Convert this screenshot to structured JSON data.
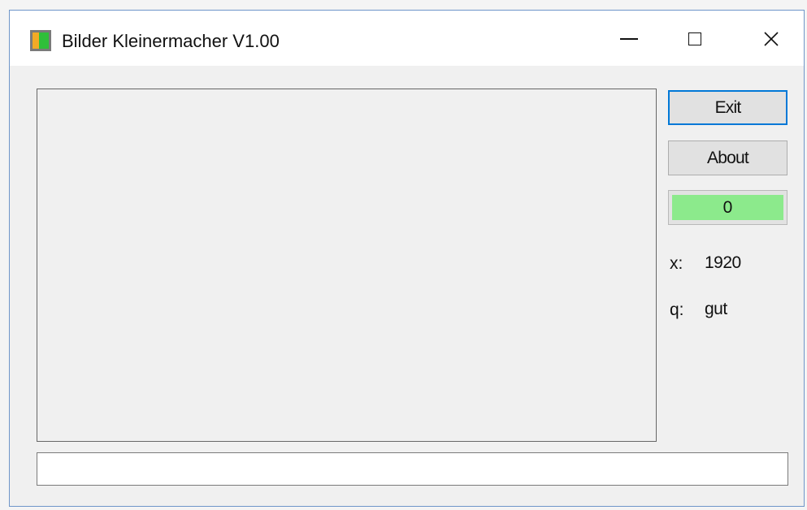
{
  "window": {
    "title": "Bilder Kleinermacher V1.00"
  },
  "controls": {
    "exit_label": "Exit",
    "about_label": "About",
    "counter_value": "0",
    "counter_color": "#8cea8c"
  },
  "info": {
    "x_label": "x:",
    "x_value": "1920",
    "q_label": "q:",
    "q_value": "gut"
  },
  "status": {
    "value": ""
  },
  "icons": {
    "app": "app-icon",
    "minimize": "minimize-icon",
    "maximize": "maximize-icon",
    "close": "close-icon"
  },
  "colors": {
    "window_border": "#6f96c9",
    "focus_border": "#0078d7",
    "button_bg": "#e1e1e1"
  }
}
